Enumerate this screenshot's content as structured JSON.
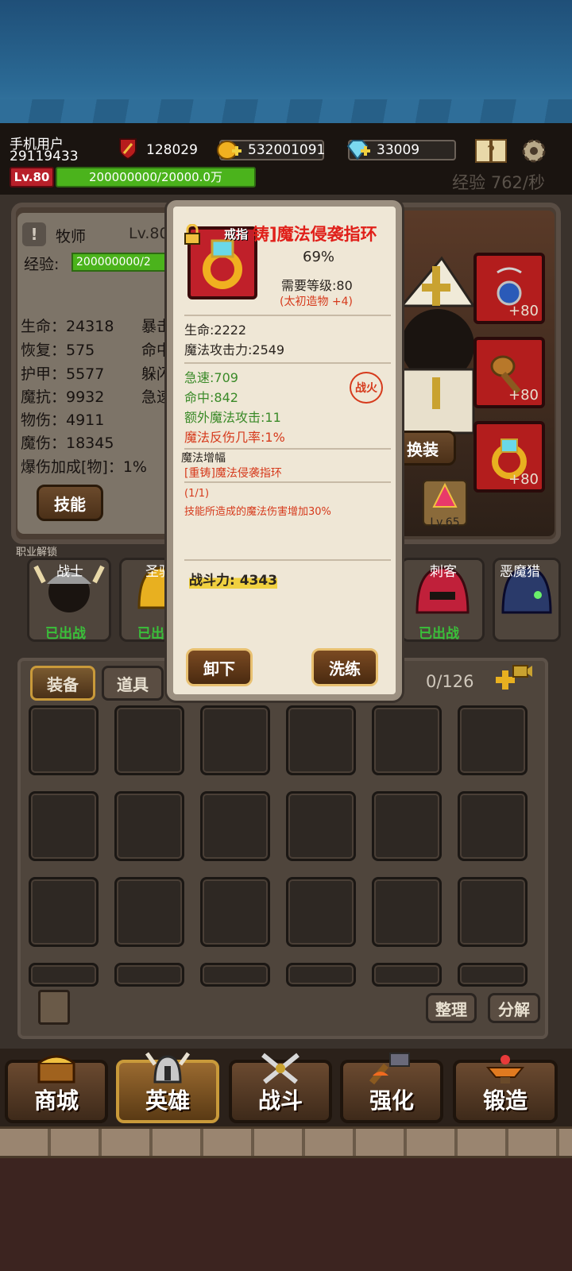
{
  "user": {
    "name": "手机用户",
    "id": "29119433",
    "level": "Lv.80",
    "exp": "200000000/20000.0万"
  },
  "resources": {
    "power": "128029",
    "gold": "532001091",
    "diamond": "33009"
  },
  "xp_rate": "经验 762/秒",
  "hero": {
    "class_name": "牧师",
    "level_label": "Lv.80",
    "exp_label": "经验:",
    "exp_value": "200000000/2"
  },
  "stats_left": [
    {
      "label": "生命：24318"
    },
    {
      "label": "恢复：575"
    },
    {
      "label": "护甲：5577"
    },
    {
      "label": "魔抗：9932"
    },
    {
      "label": "物伤：4911"
    },
    {
      "label": "魔伤：18345"
    },
    {
      "label": "爆伤加成[物]：1%"
    }
  ],
  "stats_right": [
    {
      "label": "暴击"
    },
    {
      "label": "命中"
    },
    {
      "label": "躲闪"
    },
    {
      "label": "急速"
    }
  ],
  "buttons": {
    "skill": "技能",
    "change_equip": "换装",
    "unequip": "卸下",
    "refine": "洗练",
    "sort": "整理",
    "decompose": "分解"
  },
  "slot_bonus": [
    "+80",
    "+80",
    "+80"
  ],
  "side_level": "Lv.65",
  "section_label": "职业解锁",
  "classes": [
    {
      "name": "战士",
      "status": "已出战"
    },
    {
      "name": "圣骑",
      "status": "已出"
    },
    {
      "name": "刺客",
      "status": "已出战"
    },
    {
      "name": "恶魔猎",
      "status": ""
    }
  ],
  "tabs": {
    "equip": "装备",
    "items": "道具"
  },
  "capacity": "0/126",
  "nav": [
    {
      "label": "商城",
      "icon": "treasure-chest-icon"
    },
    {
      "label": "英雄",
      "icon": "helmet-icon"
    },
    {
      "label": "战斗",
      "icon": "crossed-swords-icon"
    },
    {
      "label": "强化",
      "icon": "hammer-icon"
    },
    {
      "label": "锻造",
      "icon": "anvil-icon"
    }
  ],
  "popup": {
    "type_tag": "戒指",
    "title": "铸]魔法侵袭指环",
    "percent": "69%",
    "req_level": "需要等级:80",
    "forge_tag": "(太初造物 +4)",
    "base_stats": [
      "生命:2222",
      "魔法攻击力:2549"
    ],
    "green_stats": [
      "急速:709",
      "命中:842",
      "额外魔法攻击:11"
    ],
    "red_stat": "魔法反伤几率:1%",
    "badge": "战火",
    "enhance_label": "魔法增幅",
    "enhance_item": "[重铸]魔法侵袭指环",
    "set_count": "(1/1)",
    "set_desc": "技能所造成的魔法伤害增加30%",
    "combat_power": "战斗力: 4343"
  }
}
